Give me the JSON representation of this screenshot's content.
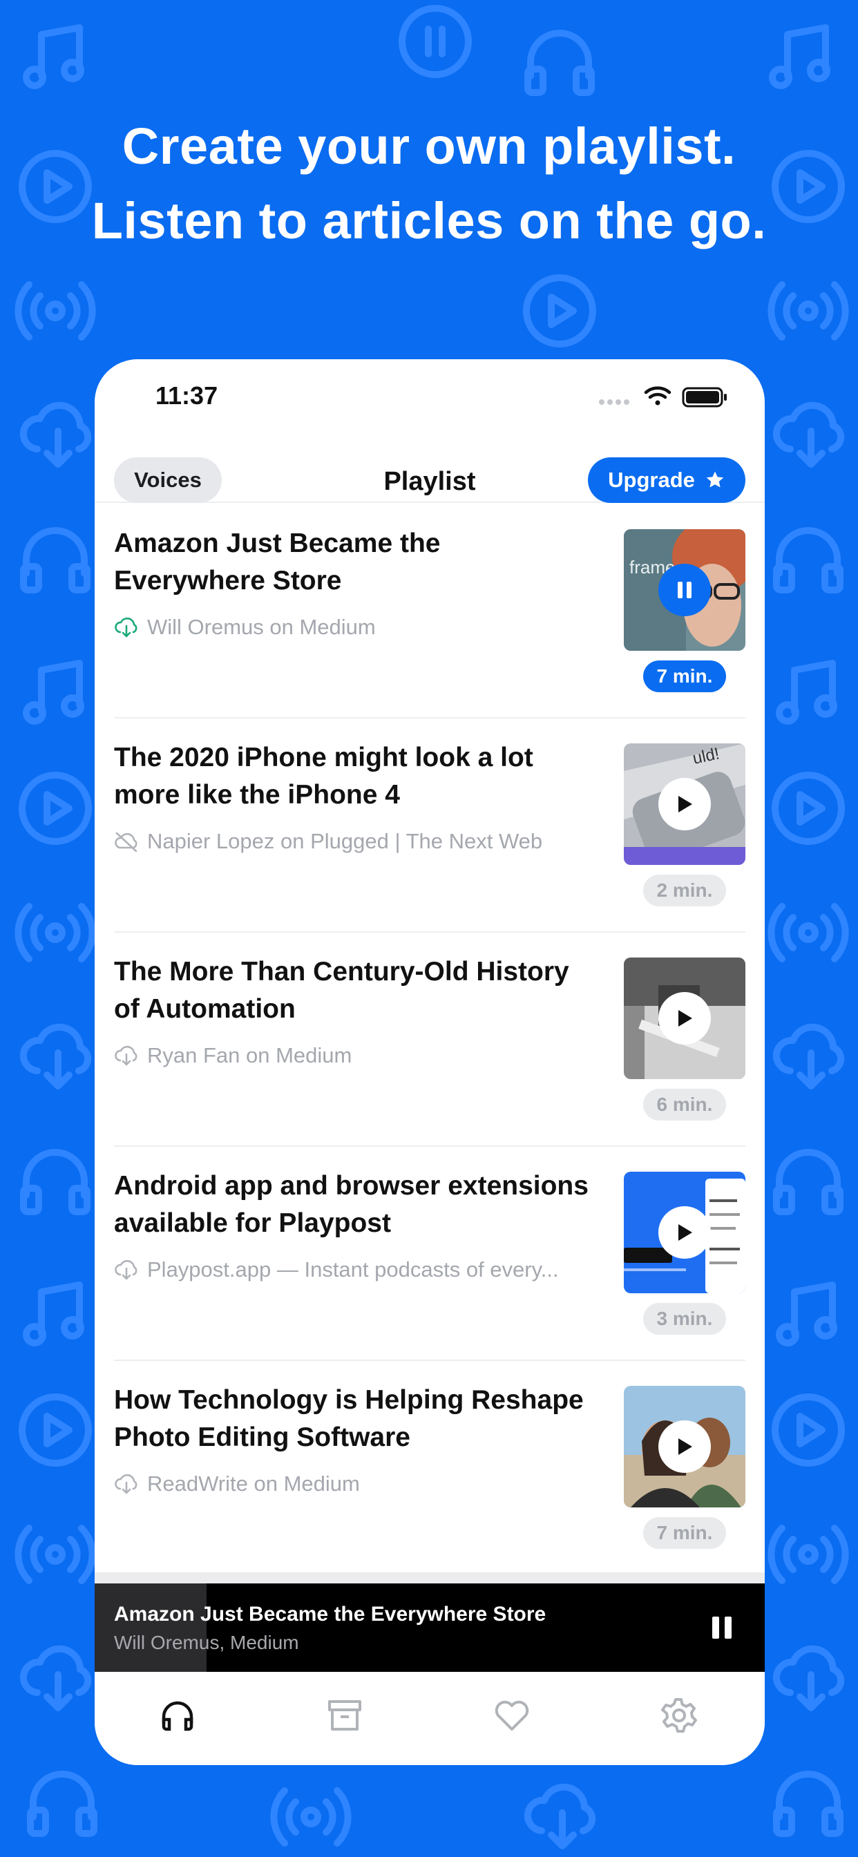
{
  "headline": {
    "line1": "Create your own playlist.",
    "line2": "Listen to articles on the go."
  },
  "status_bar": {
    "time": "11:37"
  },
  "navbar": {
    "voices_label": "Voices",
    "title": "Playlist",
    "upgrade_label": "Upgrade"
  },
  "items": [
    {
      "title": "Amazon Just Became the Everywhere Store",
      "source": "Will Oremus on Medium",
      "duration": "7 min.",
      "status": "downloaded",
      "playing": true
    },
    {
      "title": "The 2020 iPhone might look a lot more like the iPhone 4",
      "source": "Napier Lopez on Plugged | The Next Web",
      "duration": "2 min.",
      "status": "offline",
      "playing": false
    },
    {
      "title": "The More Than Century-Old History of Automation",
      "source": "Ryan Fan on Medium",
      "duration": "6 min.",
      "status": "download",
      "playing": false
    },
    {
      "title": "Android app and browser extensions available for Playpost",
      "source": "Playpost.app — Instant podcasts of every...",
      "duration": "3 min.",
      "status": "download",
      "playing": false
    },
    {
      "title": "How Technology is Helping Reshape Photo Editing Software",
      "source": "ReadWrite on Medium",
      "duration": "7 min.",
      "status": "download",
      "playing": false
    }
  ],
  "player": {
    "title": "Amazon Just Became the Everywhere Store",
    "subtitle": "Will Oremus, Medium"
  },
  "tabs": [
    "headphones-icon",
    "archive-icon",
    "heart-icon",
    "settings-icon"
  ],
  "colors": {
    "brand_blue": "#0a6cf0",
    "green": "#1aa97a",
    "grey_text": "#a4a7ad"
  }
}
